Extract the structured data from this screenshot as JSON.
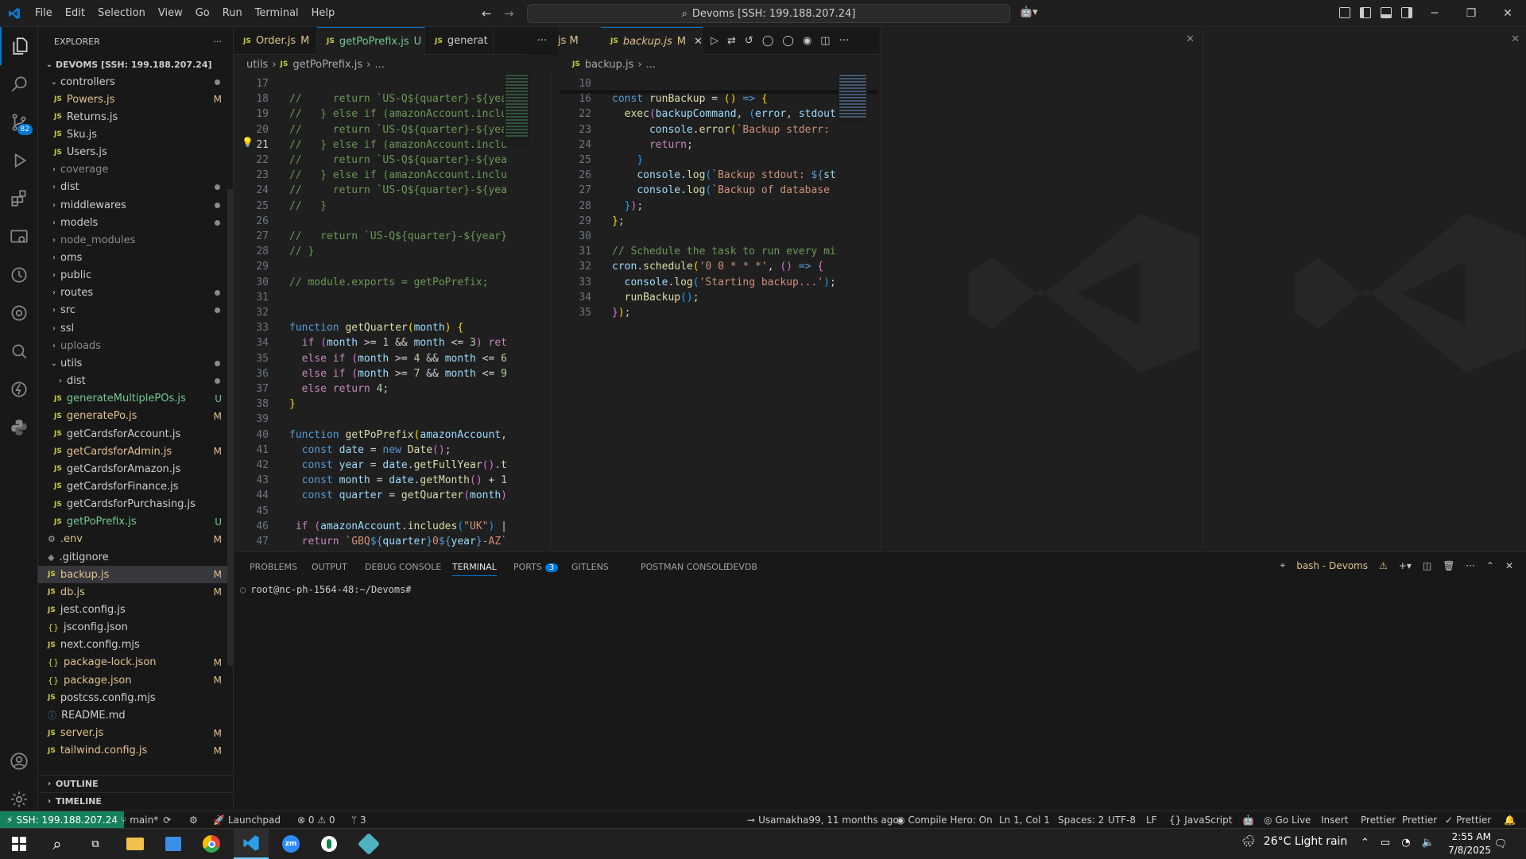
{
  "menu": [
    "File",
    "Edit",
    "Selection",
    "View",
    "Go",
    "Run",
    "Terminal",
    "Help"
  ],
  "command_center": "Devoms [SSH: 199.188.207.24]",
  "explorer": {
    "title": "EXPLORER",
    "root": "DEVOMS [SSH: 199.188.207.24]",
    "items": [
      {
        "label": "controllers",
        "type": "folder-open",
        "indent": 1,
        "status": "dot"
      },
      {
        "label": "Powers.js",
        "type": "js",
        "indent": 2,
        "status": "M"
      },
      {
        "label": "Returns.js",
        "type": "js",
        "indent": 2,
        "status": ""
      },
      {
        "label": "Sku.js",
        "type": "js",
        "indent": 2,
        "status": ""
      },
      {
        "label": "Users.js",
        "type": "js",
        "indent": 2,
        "status": ""
      },
      {
        "label": "coverage",
        "type": "folder",
        "indent": 1,
        "status": "",
        "dim": true
      },
      {
        "label": "dist",
        "type": "folder",
        "indent": 1,
        "status": "dot"
      },
      {
        "label": "middlewares",
        "type": "folder",
        "indent": 1,
        "status": "dot"
      },
      {
        "label": "models",
        "type": "folder",
        "indent": 1,
        "status": "dot"
      },
      {
        "label": "node_modules",
        "type": "folder",
        "indent": 1,
        "status": "",
        "dim": true
      },
      {
        "label": "oms",
        "type": "folder",
        "indent": 1,
        "status": ""
      },
      {
        "label": "public",
        "type": "folder",
        "indent": 1,
        "status": ""
      },
      {
        "label": "routes",
        "type": "folder",
        "indent": 1,
        "status": "dot"
      },
      {
        "label": "src",
        "type": "folder",
        "indent": 1,
        "status": "dot"
      },
      {
        "label": "ssl",
        "type": "folder",
        "indent": 1,
        "status": ""
      },
      {
        "label": "uploads",
        "type": "folder",
        "indent": 1,
        "status": "",
        "dim": true
      },
      {
        "label": "utils",
        "type": "folder-open",
        "indent": 1,
        "status": "dot"
      },
      {
        "label": "dist",
        "type": "folder",
        "indent": 2,
        "status": "dot"
      },
      {
        "label": "generateMultiplePOs.js",
        "type": "js",
        "indent": 2,
        "status": "U"
      },
      {
        "label": "generatePo.js",
        "type": "js",
        "indent": 2,
        "status": "M"
      },
      {
        "label": "getCardsforAccount.js",
        "type": "js",
        "indent": 2,
        "status": ""
      },
      {
        "label": "getCardsforAdmin.js",
        "type": "js",
        "indent": 2,
        "status": "M"
      },
      {
        "label": "getCardsforAmazon.js",
        "type": "js",
        "indent": 2,
        "status": ""
      },
      {
        "label": "getCardsforFinance.js",
        "type": "js",
        "indent": 2,
        "status": ""
      },
      {
        "label": "getCardsforPurchasing.js",
        "type": "js",
        "indent": 2,
        "status": ""
      },
      {
        "label": "getPoPrefix.js",
        "type": "js",
        "indent": 2,
        "status": "U"
      },
      {
        "label": ".env",
        "type": "gear",
        "indent": 1,
        "status": "M"
      },
      {
        "label": ".gitignore",
        "type": "git",
        "indent": 1,
        "status": ""
      },
      {
        "label": "backup.js",
        "type": "js",
        "indent": 1,
        "status": "M",
        "selected": true
      },
      {
        "label": "db.js",
        "type": "js",
        "indent": 1,
        "status": "M"
      },
      {
        "label": "jest.config.js",
        "type": "js",
        "indent": 1,
        "status": ""
      },
      {
        "label": "jsconfig.json",
        "type": "json",
        "indent": 1,
        "status": ""
      },
      {
        "label": "next.config.mjs",
        "type": "js",
        "indent": 1,
        "status": ""
      },
      {
        "label": "package-lock.json",
        "type": "json",
        "indent": 1,
        "status": "M"
      },
      {
        "label": "package.json",
        "type": "json",
        "indent": 1,
        "status": "M"
      },
      {
        "label": "postcss.config.mjs",
        "type": "js",
        "indent": 1,
        "status": ""
      },
      {
        "label": "README.md",
        "type": "info",
        "indent": 1,
        "status": ""
      },
      {
        "label": "server.js",
        "type": "js",
        "indent": 1,
        "status": "M"
      },
      {
        "label": "tailwind.config.js",
        "type": "js",
        "indent": 1,
        "status": "M"
      }
    ],
    "outline": "OUTLINE",
    "timeline": "TIMELINE"
  },
  "tabs_left": [
    {
      "label": "Order.js",
      "status": "M",
      "icon": "JS"
    },
    {
      "label": "getPoPrefix.js",
      "status": "U",
      "icon": "JS",
      "active": true
    },
    {
      "label": "generat",
      "status": "",
      "icon": "JS"
    }
  ],
  "tabs_left_more": "js M",
  "tab_right": {
    "label": "backup.js",
    "status": "M",
    "icon": "JS"
  },
  "breadcrumb_left": [
    "utils",
    "getPoPrefix.js",
    "..."
  ],
  "breadcrumb_right": [
    "backup.js",
    "..."
  ],
  "editor_left_lines": [
    "17",
    "18",
    "19",
    "20",
    "21",
    "22",
    "23",
    "24",
    "25",
    "26",
    "27",
    "28",
    "29",
    "30",
    "31",
    "32",
    "33",
    "34",
    "35",
    "36",
    "37",
    "38",
    "39",
    "40",
    "41",
    "42",
    "43",
    "44",
    "45",
    "46",
    "47"
  ],
  "editor_right_lines": [
    "10",
    "16",
    "22",
    "23",
    "24",
    "25",
    "26",
    "27",
    "28",
    "29",
    "30",
    "31",
    "32",
    "33",
    "34",
    "35"
  ],
  "panel": {
    "tabs": [
      "PROBLEMS",
      "OUTPUT",
      "DEBUG CONSOLE",
      "TERMINAL",
      "PORTS",
      "GITLENS",
      "POSTMAN CONSOLE",
      "DEVDB"
    ],
    "ports_badge": "3",
    "terminal_name": "bash - Devoms",
    "prompt": "root@nc-ph-1564-48:~/Devoms#"
  },
  "status": {
    "remote": "SSH: 199.188.207.24",
    "branch": "main*",
    "launchpad": "Launchpad",
    "errors": "0",
    "warnings": "0",
    "ports": "3",
    "blame": "Usamakha99, 11 months ago",
    "compile_hero": "Compile Hero: On",
    "cursor": "Ln 1, Col 1",
    "spaces": "Spaces: 2",
    "encoding": "UTF-8",
    "eol": "LF",
    "language": "JavaScript",
    "golive": "Go Live",
    "insert": "Insert",
    "prettier1": "Prettier",
    "prettier2": "Prettier",
    "prettier3": "Prettier"
  },
  "taskbar": {
    "weather": "26°C  Light rain",
    "time": "2:55 AM",
    "date": "7/8/2025"
  },
  "colors": {
    "accent": "#0078d4",
    "remote": "#16825d",
    "modified": "#e2c08d",
    "untracked": "#73c991"
  }
}
